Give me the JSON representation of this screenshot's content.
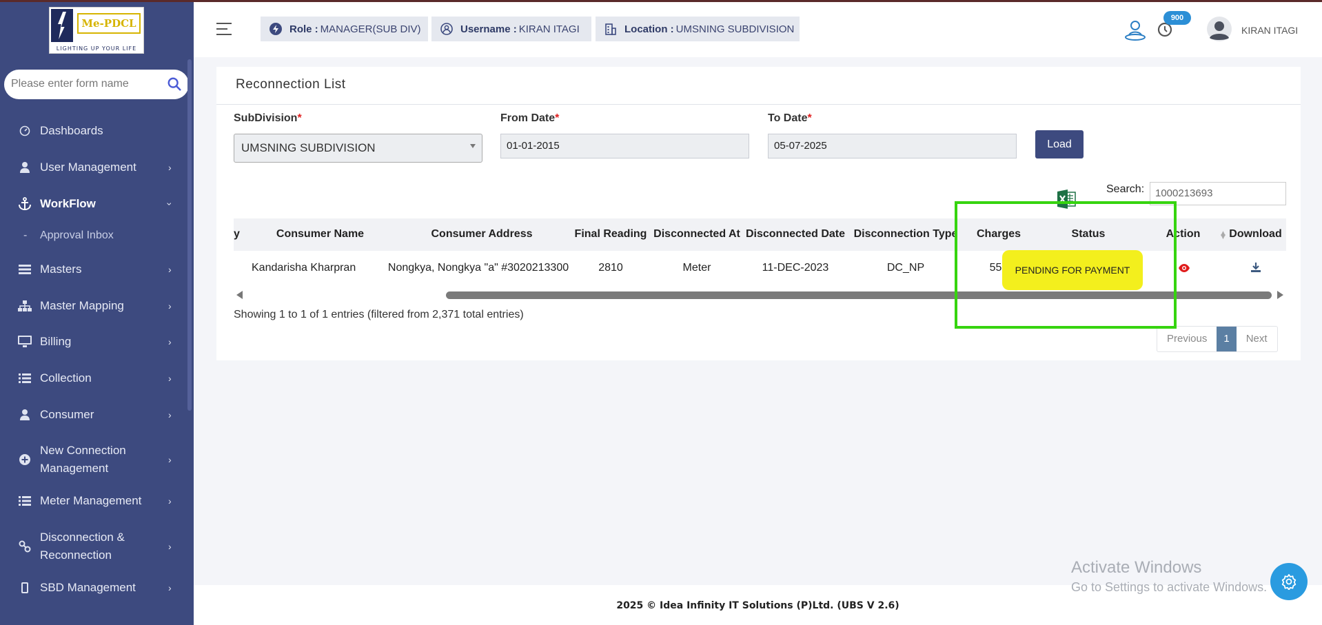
{
  "brand": {
    "logo_text": "Me-PDCL",
    "tagline": "LIGHTING UP YOUR LIFE"
  },
  "sidebar": {
    "search_placeholder": "Please enter form name",
    "items": [
      {
        "label": "Dashboards",
        "icon": "gauge-icon",
        "has_children": false
      },
      {
        "label": "User Management",
        "icon": "user-icon",
        "has_children": true
      },
      {
        "label": "WorkFlow",
        "icon": "anchor-icon",
        "has_children": true,
        "expanded": true
      },
      {
        "label": "Masters",
        "icon": "list-icon",
        "has_children": true
      },
      {
        "label": "Master Mapping",
        "icon": "sitemap-icon",
        "has_children": true
      },
      {
        "label": "Billing",
        "icon": "monitor-icon",
        "has_children": true
      },
      {
        "label": "Collection",
        "icon": "list-icon",
        "has_children": true
      },
      {
        "label": "Consumer",
        "icon": "user-icon",
        "has_children": true
      },
      {
        "label": "New Connection Management",
        "icon": "plus-circle-icon",
        "has_children": true
      },
      {
        "label": "Meter Management",
        "icon": "list-icon",
        "has_children": true
      },
      {
        "label": "Disconnection & Reconnection",
        "icon": "link-icon",
        "has_children": true
      },
      {
        "label": "SBD Management",
        "icon": "device-icon",
        "has_children": true
      }
    ],
    "workflow_sub": "Approval Inbox"
  },
  "header": {
    "role_label": "Role :",
    "role_value": "MANAGER(SUB DIV)",
    "username_label": "Username :",
    "username_value": "KIRAN ITAGI",
    "location_label": "Location :",
    "location_value": "UMSNING SUBDIVISION",
    "notification_count": "900",
    "user_name": "KIRAN ITAGI"
  },
  "page": {
    "title": "Reconnection List",
    "subdivision_label": "SubDivision",
    "subdivision_value": "UMSNING SUBDIVISION",
    "from_date_label": "From Date",
    "from_date_value": "01-01-2015",
    "to_date_label": "To Date",
    "to_date_value": "05-07-2025",
    "required_mark": "*",
    "load_label": "Load",
    "search_label": "Search:",
    "search_value": "1000213693"
  },
  "table": {
    "columns": [
      "y",
      "Consumer Name",
      "Consumer Address",
      "Final Reading",
      "Disconnected At",
      "Disconnected Date",
      "Disconnection Type",
      "Charges",
      "Status",
      "Action",
      "Download"
    ],
    "row": {
      "consumer_name": "Kandarisha Kharpran",
      "consumer_address": "Nongkya, Nongkya \"a\" #3020213300",
      "final_reading": "2810",
      "disconnected_at": "Meter",
      "disconnected_date": "11-DEC-2023",
      "disconnection_type": "DC_NP",
      "charges": "550",
      "status": "PENDING FOR PAYMENT"
    }
  },
  "pagination": {
    "info": "Showing 1 to 1 of 1 entries (filtered from 2,371 total entries)",
    "previous": "Previous",
    "current": "1",
    "next": "Next"
  },
  "footer": {
    "text": "2025 © Idea Infinity IT Solutions (P)Ltd. (UBS V 2.6)"
  },
  "watermark": {
    "line1": "Activate Windows",
    "line2": "Go to Settings to activate Windows."
  },
  "colors": {
    "sidebar": "#3d4a7f",
    "accent": "#2a9be0",
    "status_highlight": "#f3ef1d",
    "annotation_box": "#36d40f"
  }
}
